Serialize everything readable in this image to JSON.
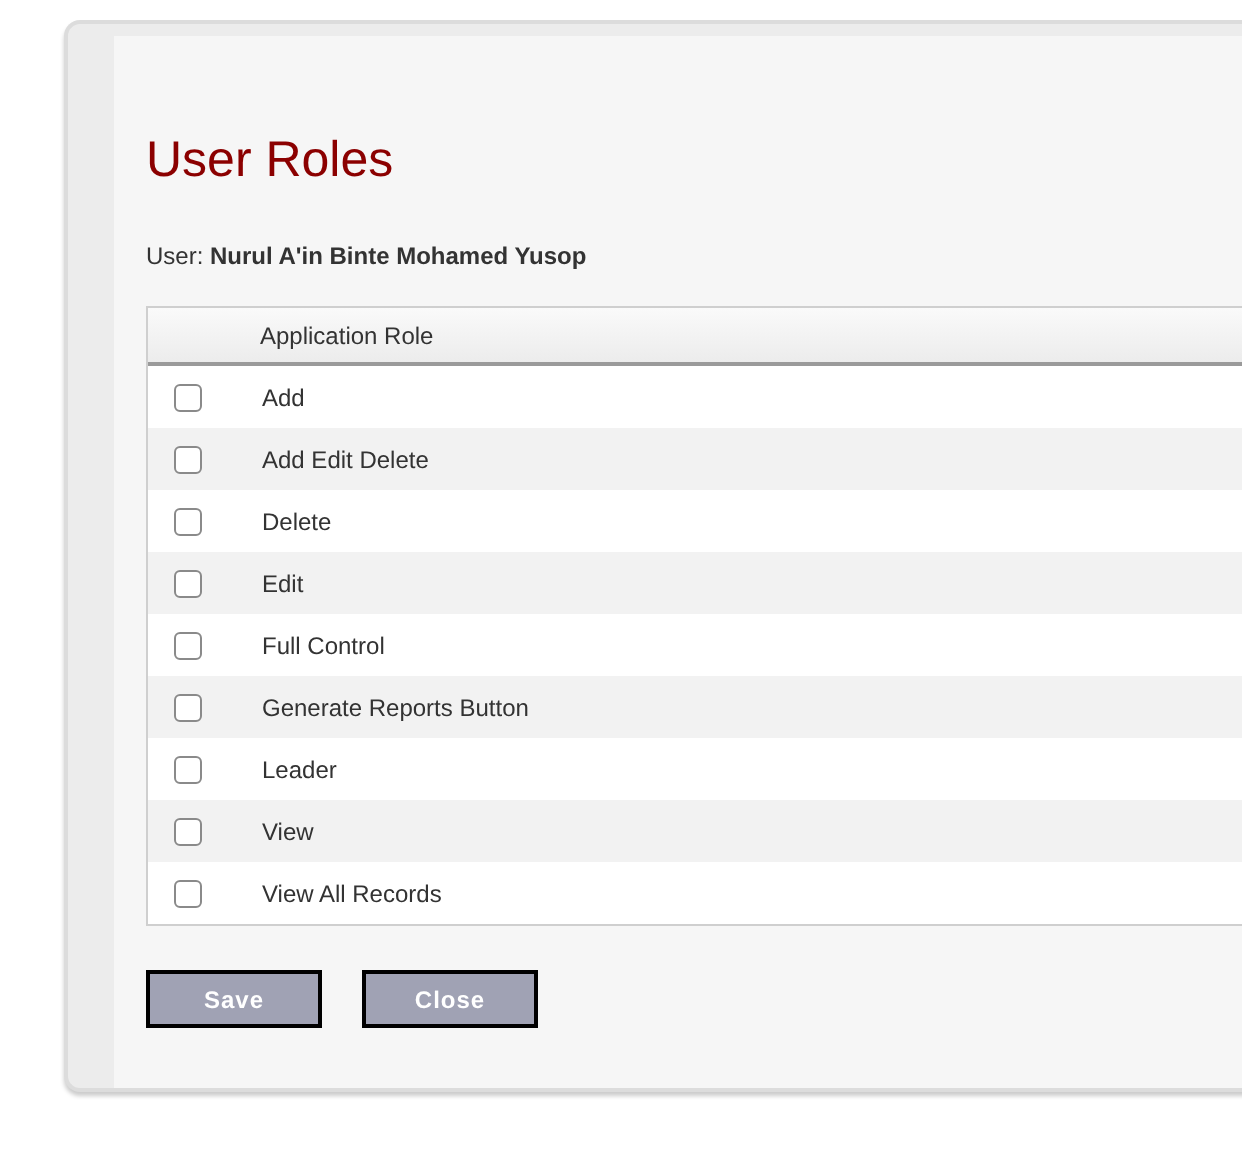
{
  "title": "User Roles",
  "user": {
    "label": "User:",
    "name": "Nurul A'in Binte Mohamed Yusop"
  },
  "table": {
    "columns": [
      "Application Role"
    ],
    "rows": [
      {
        "role": "Add",
        "checked": false
      },
      {
        "role": "Add Edit Delete",
        "checked": false
      },
      {
        "role": "Delete",
        "checked": false
      },
      {
        "role": "Edit",
        "checked": false
      },
      {
        "role": "Full Control",
        "checked": false
      },
      {
        "role": "Generate Reports Button",
        "checked": false
      },
      {
        "role": "Leader",
        "checked": false
      },
      {
        "role": "View",
        "checked": false
      },
      {
        "role": "View All Records",
        "checked": false
      }
    ]
  },
  "buttons": [
    "Save",
    "Close"
  ]
}
